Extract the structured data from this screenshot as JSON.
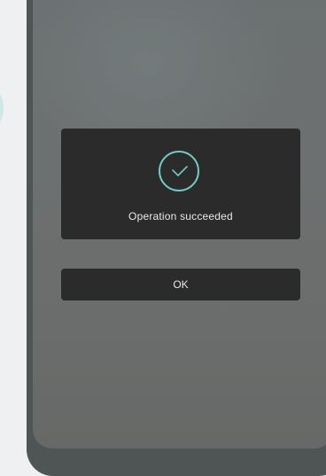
{
  "dialog": {
    "message": "Operation succeeded",
    "icon": "check-circle-icon",
    "ok_label": "OK"
  },
  "colors": {
    "accent": "#74c7c3",
    "card_bg": "#2b2b2b",
    "screen_bg": "#6b6e6e",
    "text": "#e8e8e8"
  }
}
